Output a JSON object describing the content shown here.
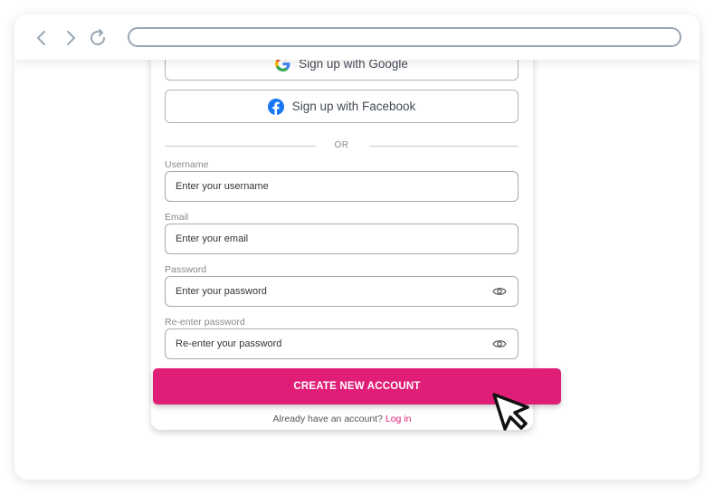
{
  "signup": {
    "google_label": "Sign up with Google",
    "facebook_label": "Sign up with Facebook",
    "divider_text": "OR",
    "fields": [
      {
        "label": "Username",
        "placeholder": "Enter your username"
      },
      {
        "label": "Email",
        "placeholder": "Enter your email"
      },
      {
        "label": "Password",
        "placeholder": "Enter your password",
        "icon": "eye-icon"
      },
      {
        "label": "Re-enter password",
        "placeholder": "Re-enter your password",
        "icon": "eye-icon"
      }
    ],
    "submit_label": "CREATE NEW ACCOUNT",
    "login_prompt": "Already have an account?",
    "login_link": "Log in"
  },
  "browser": {
    "icons": [
      "back-icon",
      "forward-icon",
      "reload-icon"
    ],
    "address_value": ""
  },
  "colors": {
    "accent": "#e01e78",
    "facebook": "#1877f2"
  }
}
